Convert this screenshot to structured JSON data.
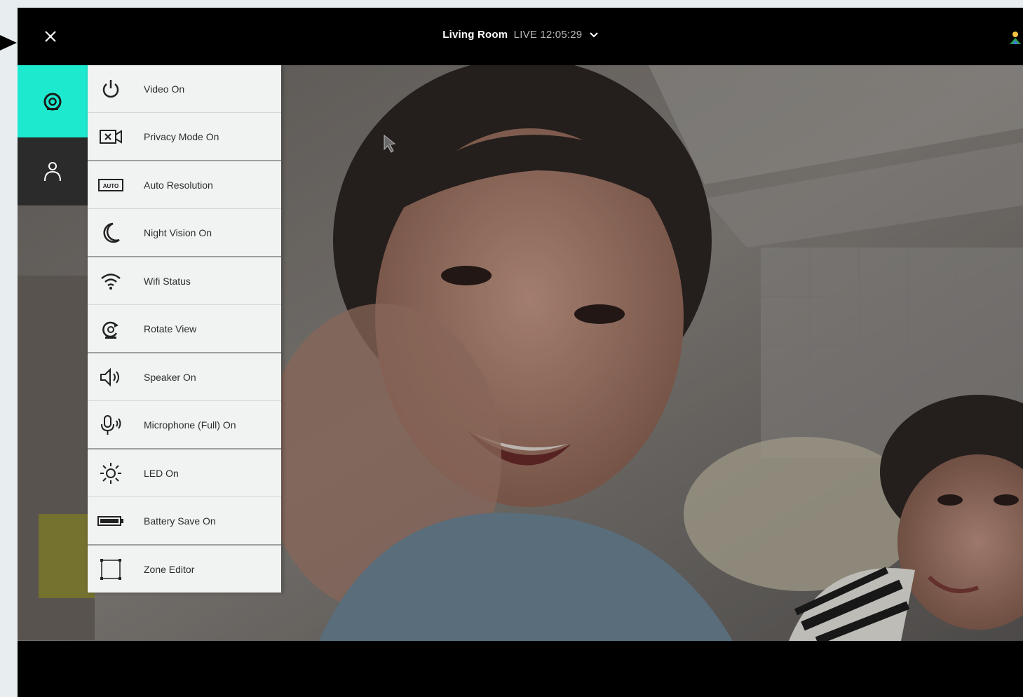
{
  "header": {
    "camera_name": "Living Room",
    "live_label": "LIVE 12:05:29"
  },
  "sidebar_tabs": [
    {
      "icon": "camera-icon",
      "active": true
    },
    {
      "icon": "user-icon",
      "active": false
    }
  ],
  "menu": {
    "items": [
      {
        "label": "Video On",
        "icon": "power-icon"
      },
      {
        "label": "Privacy Mode On",
        "icon": "privacy-camera-icon"
      },
      {
        "label": "Auto Resolution",
        "icon": "resolution-icon"
      },
      {
        "label": "Night Vision On",
        "icon": "moon-icon"
      },
      {
        "label": "Wifi Status",
        "icon": "wifi-icon"
      },
      {
        "label": "Rotate View",
        "icon": "rotate-icon"
      },
      {
        "label": "Speaker On",
        "icon": "speaker-icon"
      },
      {
        "label": "Microphone (Full) On",
        "icon": "microphone-icon"
      },
      {
        "label": "LED On",
        "icon": "led-sun-icon"
      },
      {
        "label": "Battery Save On",
        "icon": "battery-icon"
      },
      {
        "label": "Zone Editor",
        "icon": "zone-editor-icon"
      }
    ]
  },
  "colors": {
    "accent": "#1de9cf",
    "menu_bg": "#f1f2f2",
    "bar_bg": "#000000"
  }
}
